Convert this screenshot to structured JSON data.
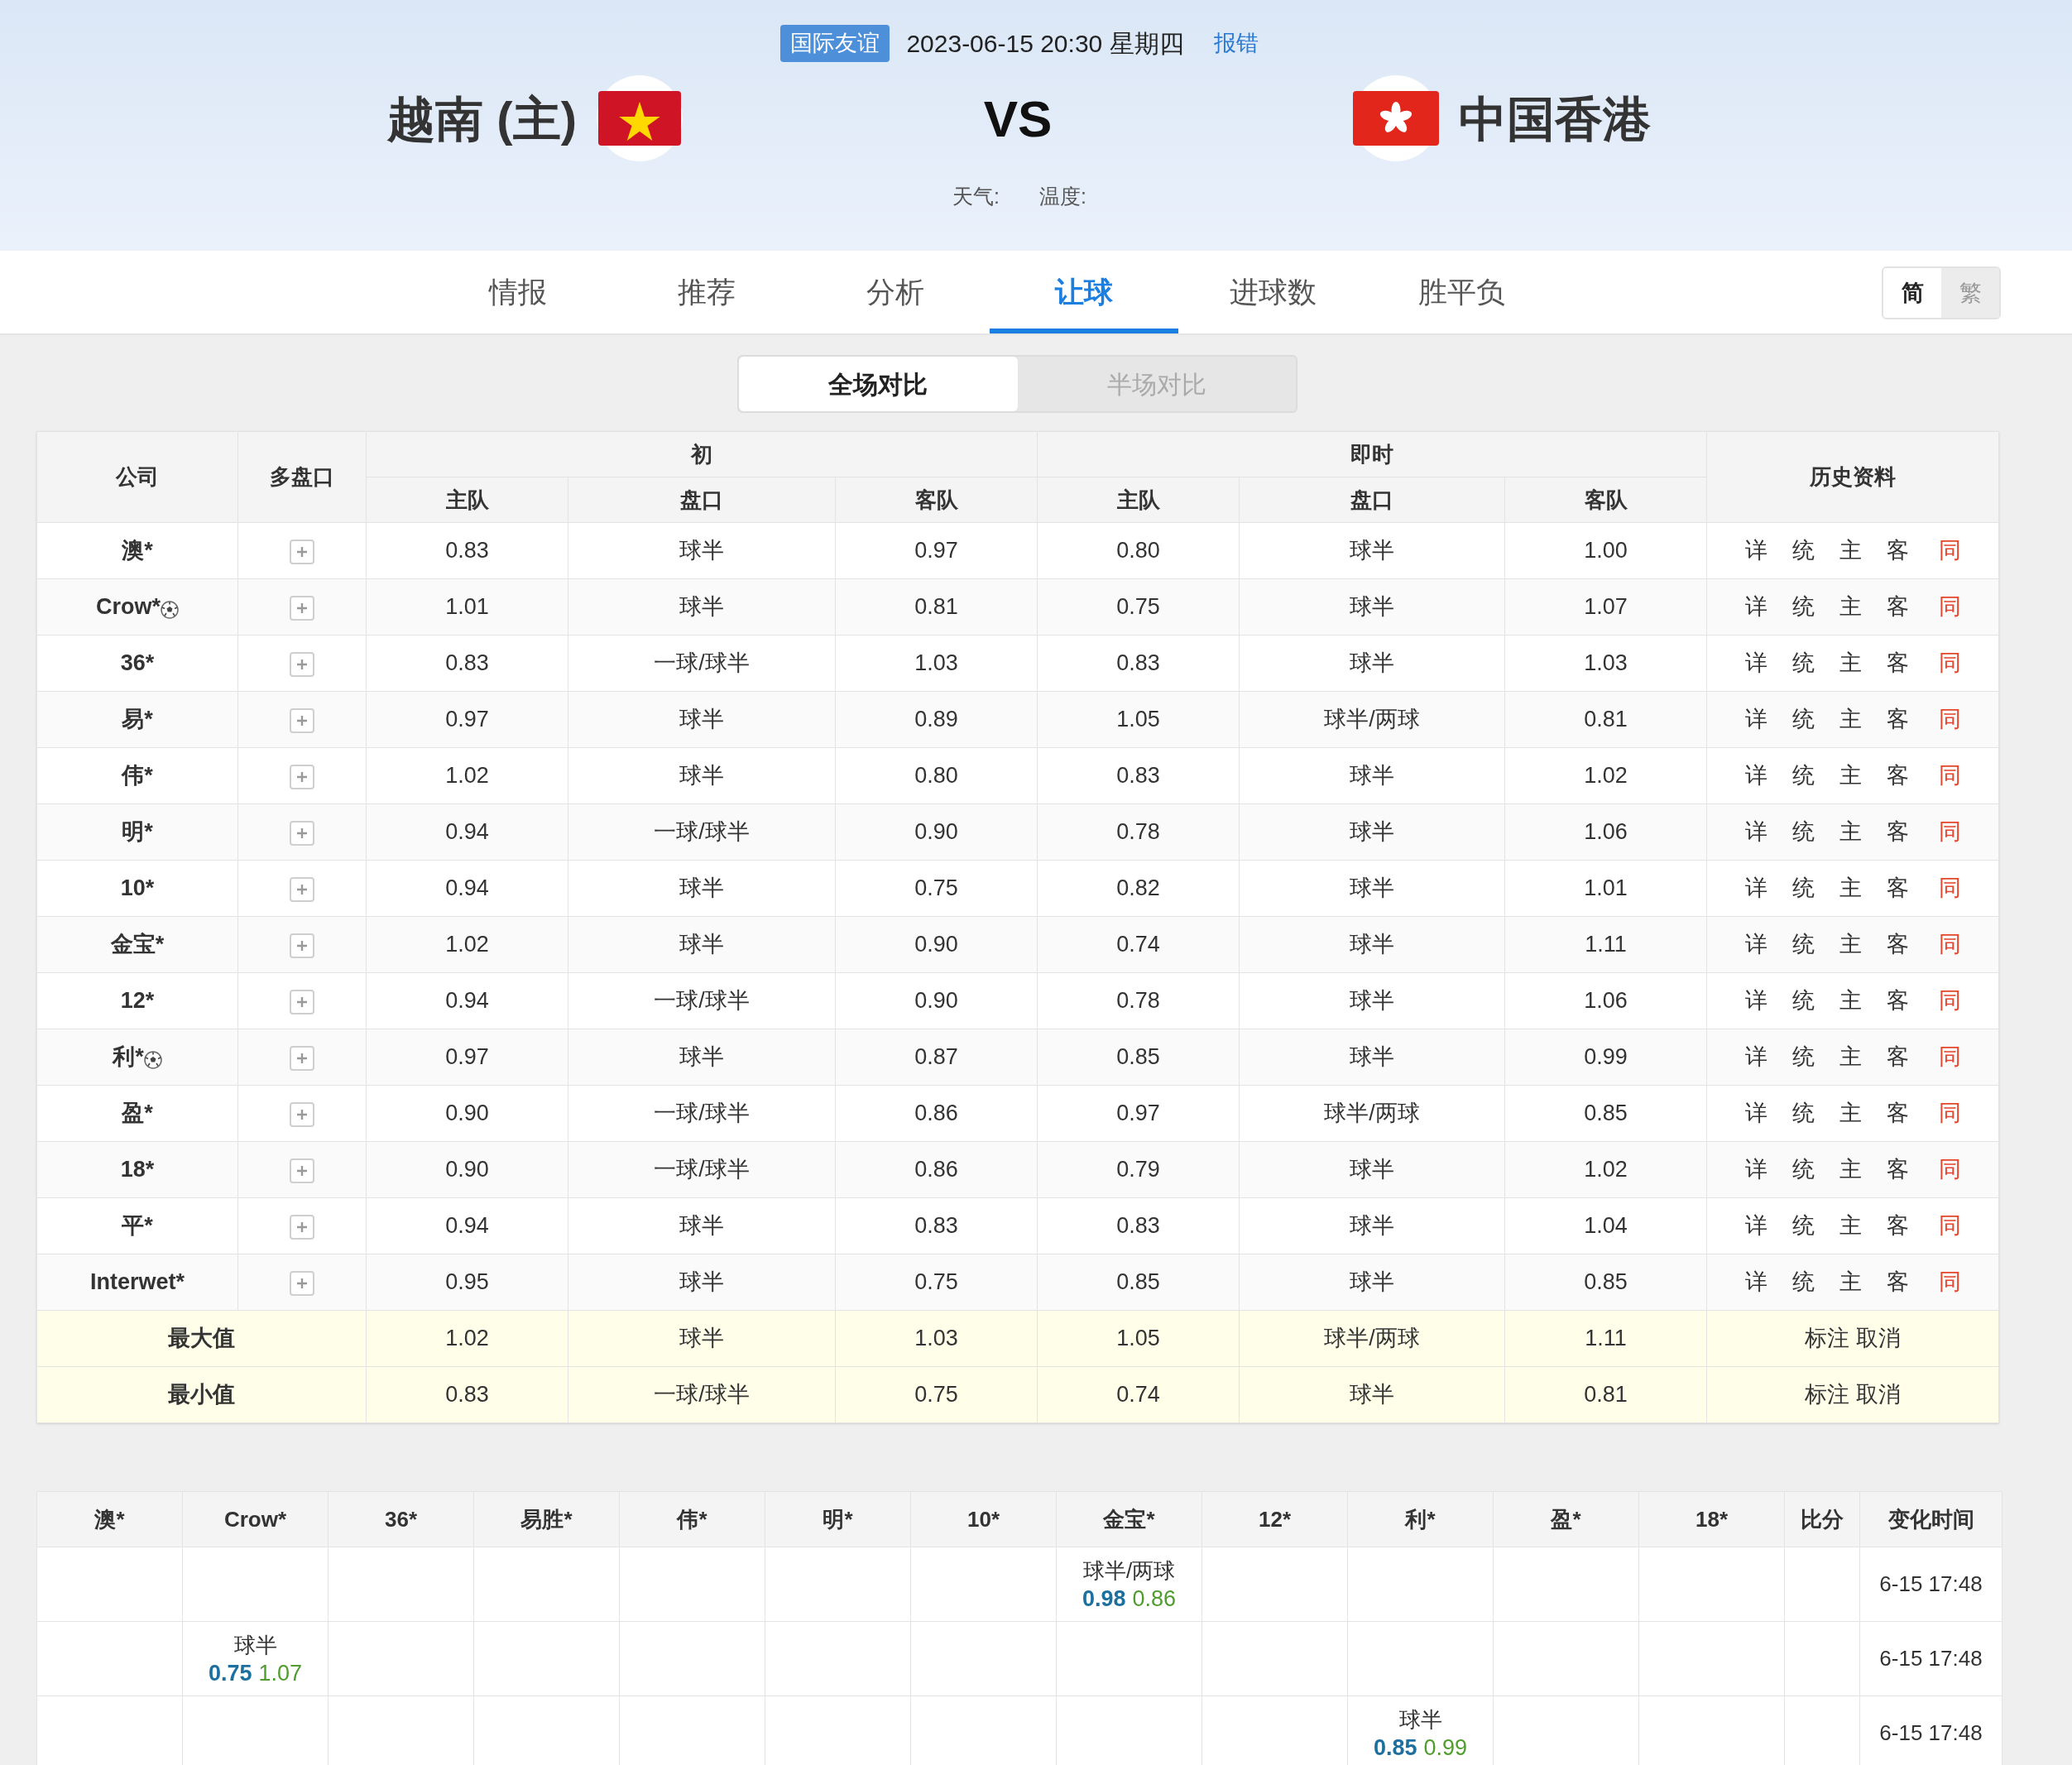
{
  "header": {
    "league_badge": "国际友谊",
    "datetime": "2023-06-15 20:30 星期四",
    "report_link": "报错",
    "home_team": "越南 (主)",
    "vs": "VS",
    "away_team": "中国香港",
    "weather_label": "天气:",
    "temperature_label": "温度:"
  },
  "tabs": [
    {
      "label": "情报",
      "selected": false
    },
    {
      "label": "推荐",
      "selected": false
    },
    {
      "label": "分析",
      "selected": false
    },
    {
      "label": "让球",
      "selected": true
    },
    {
      "label": "进球数",
      "selected": false
    },
    {
      "label": "胜平负",
      "selected": false
    }
  ],
  "script_toggle": [
    {
      "label": "简",
      "selected": true
    },
    {
      "label": "繁",
      "selected": false
    }
  ],
  "compare_toggle": [
    {
      "label": "全场对比",
      "selected": true
    },
    {
      "label": "半场对比",
      "selected": false
    }
  ],
  "odds_table": {
    "company_header": "公司",
    "multi_header": "多盘口",
    "initial_header": "初",
    "live_header": "即时",
    "history_header": "历史资料",
    "sub_columns": [
      "主队",
      "盘口",
      "客队",
      "主队",
      "盘口",
      "客队"
    ],
    "rows": [
      {
        "company": "澳*",
        "ball_icon": false,
        "values": [
          "0.83",
          "球半",
          "0.97",
          "0.80",
          "球半",
          "1.00"
        ],
        "history": [
          "详",
          "统",
          "主",
          "客",
          "同"
        ]
      },
      {
        "company": "Crow*",
        "ball_icon": true,
        "values": [
          "1.01",
          "球半",
          "0.81",
          "0.75",
          "球半",
          "1.07"
        ],
        "history": [
          "详",
          "统",
          "主",
          "客",
          "同"
        ]
      },
      {
        "company": "36*",
        "ball_icon": false,
        "values": [
          "0.83",
          "一球/球半",
          "1.03",
          "0.83",
          "球半",
          "1.03"
        ],
        "history": [
          "详",
          "统",
          "主",
          "客",
          "同"
        ]
      },
      {
        "company": "易*",
        "ball_icon": false,
        "values": [
          "0.97",
          "球半",
          "0.89",
          "1.05",
          "球半/两球",
          "0.81"
        ],
        "history": [
          "详",
          "统",
          "主",
          "客",
          "同"
        ]
      },
      {
        "company": "伟*",
        "ball_icon": false,
        "values": [
          "1.02",
          "球半",
          "0.80",
          "0.83",
          "球半",
          "1.02"
        ],
        "history": [
          "详",
          "统",
          "主",
          "客",
          "同"
        ]
      },
      {
        "company": "明*",
        "ball_icon": false,
        "values": [
          "0.94",
          "一球/球半",
          "0.90",
          "0.78",
          "球半",
          "1.06"
        ],
        "history": [
          "详",
          "统",
          "主",
          "客",
          "同"
        ]
      },
      {
        "company": "10*",
        "ball_icon": false,
        "values": [
          "0.94",
          "球半",
          "0.75",
          "0.82",
          "球半",
          "1.01"
        ],
        "history": [
          "详",
          "统",
          "主",
          "客",
          "同"
        ]
      },
      {
        "company": "金宝*",
        "ball_icon": false,
        "values": [
          "1.02",
          "球半",
          "0.90",
          "0.74",
          "球半",
          "1.11"
        ],
        "history": [
          "详",
          "统",
          "主",
          "客",
          "同"
        ]
      },
      {
        "company": "12*",
        "ball_icon": false,
        "values": [
          "0.94",
          "一球/球半",
          "0.90",
          "0.78",
          "球半",
          "1.06"
        ],
        "history": [
          "详",
          "统",
          "主",
          "客",
          "同"
        ]
      },
      {
        "company": "利*",
        "ball_icon": true,
        "values": [
          "0.97",
          "球半",
          "0.87",
          "0.85",
          "球半",
          "0.99"
        ],
        "history": [
          "详",
          "统",
          "主",
          "客",
          "同"
        ]
      },
      {
        "company": "盈*",
        "ball_icon": false,
        "values": [
          "0.90",
          "一球/球半",
          "0.86",
          "0.97",
          "球半/两球",
          "0.85"
        ],
        "history": [
          "详",
          "统",
          "主",
          "客",
          "同"
        ]
      },
      {
        "company": "18*",
        "ball_icon": false,
        "values": [
          "0.90",
          "一球/球半",
          "0.86",
          "0.79",
          "球半",
          "1.02"
        ],
        "history": [
          "详",
          "统",
          "主",
          "客",
          "同"
        ]
      },
      {
        "company": "平*",
        "ball_icon": false,
        "values": [
          "0.94",
          "球半",
          "0.83",
          "0.83",
          "球半",
          "1.04"
        ],
        "history": [
          "详",
          "统",
          "主",
          "客",
          "同"
        ]
      },
      {
        "company": "Interwet*",
        "ball_icon": false,
        "values": [
          "0.95",
          "球半",
          "0.75",
          "0.85",
          "球半",
          "0.85"
        ],
        "history": [
          "详",
          "统",
          "主",
          "客",
          "同"
        ]
      }
    ],
    "summary_rows": [
      {
        "label": "最大值",
        "values": [
          "1.02",
          "球半",
          "1.03",
          "1.05",
          "球半/两球",
          "1.11"
        ],
        "actions": [
          "标注",
          "取消"
        ]
      },
      {
        "label": "最小值",
        "values": [
          "0.83",
          "一球/球半",
          "0.75",
          "0.74",
          "球半",
          "0.81"
        ],
        "actions": [
          "标注",
          "取消"
        ]
      }
    ]
  },
  "changes_table": {
    "columns": [
      "澳*",
      "Crow*",
      "36*",
      "易胜*",
      "伟*",
      "明*",
      "10*",
      "金宝*",
      "12*",
      "利*",
      "盈*",
      "18*",
      "比分",
      "变化时间"
    ],
    "rows": [
      {
        "cells": [
          null,
          null,
          null,
          null,
          null,
          null,
          null,
          {
            "line": "球半/两球",
            "home": "0.98",
            "away": "0.86"
          },
          null,
          null,
          null,
          null,
          null
        ],
        "time": "6-15 17:48"
      },
      {
        "cells": [
          null,
          {
            "line": "球半",
            "home": "0.75",
            "away": "1.07"
          },
          null,
          null,
          null,
          null,
          null,
          null,
          null,
          null,
          null,
          null,
          null
        ],
        "time": "6-15 17:48"
      },
      {
        "cells": [
          null,
          null,
          null,
          null,
          null,
          null,
          null,
          null,
          null,
          {
            "line": "球半",
            "home": "0.85",
            "away": "0.99"
          },
          null,
          null,
          null
        ],
        "time": "6-15 17:48"
      }
    ]
  }
}
